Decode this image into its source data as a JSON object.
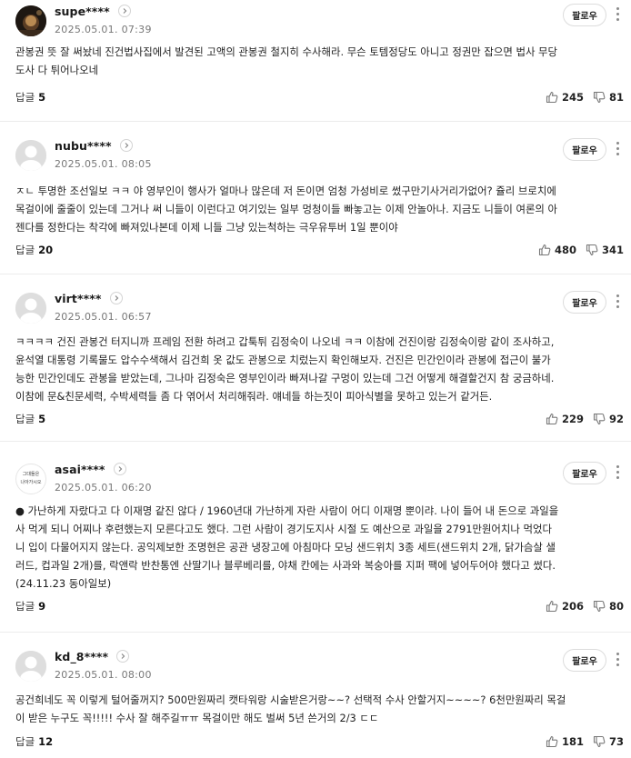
{
  "follow_label": "팔로우",
  "reply_label": "답글",
  "comments": [
    {
      "nickname": "supe****",
      "date": "2025.05.01. 07:39",
      "avatar": "photo",
      "text": "관봉권 뜻 잘 써놨네 진건법사집에서 발견된 고액의 관봉권 철지히 수사해라. 무슨 토템정당도 아니고 정권만 잡으면 법사 무당\n도사 다 튀어나오네",
      "replies": "5",
      "likes": "245",
      "dislikes": "81"
    },
    {
      "nickname": "nubu****",
      "date": "2025.05.01. 08:05",
      "avatar": "default",
      "text": "ㅈㄴ 투명한 조선일보 ㅋㅋ 야 영부인이 행사가 얼마나 많은데 저 돈이면 엄청 가성비로 썼구만기사거리가없어? 쥴리 브로치에\n목걸이에 줄줄이 있는데 그거나 써 니들이 이런다고 여기있는 일부 멍청이들 빠놓고는 이제 안놀아나. 지금도 니들이 여론의 아\n젠다를 정한다는 착각에 빠져있나본데 이제 니들 그냥 있는척하는 극우유투버 1일 뿐이야",
      "replies": "20",
      "likes": "480",
      "dislikes": "341"
    },
    {
      "nickname": "virt****",
      "date": "2025.05.01. 06:57",
      "avatar": "default",
      "text": "ㅋㅋㅋㅋ 건진 관봉건 터지니까 프레임 전환 하려고 갑툭튀 김정숙이 나오네 ㅋㅋ 이참에 건진이랑 김정숙이랑 같이 조사하고,\n윤석열 대통령 기록물도 압수수색해서 김건희 옷 값도 관봉으로 치렀는지 확인해보자. 건진은 민간인이라 관봉에 접근이 불가\n능한 민간인데도 관봉을 받았는데, 그나마 김정숙은 영부인이라 빠져나갈 구멍이 있는데 그건 어떻게 해결할건지 참 궁금하네.\n이참에 문&친문세력, 수박세력들 좀 다 엮어서 처리해줘라. 얘네들 하는짓이 피아식별을 못하고 있는거 같거든.",
      "replies": "5",
      "likes": "229",
      "dislikes": "92"
    },
    {
      "nickname": "asai****",
      "date": "2025.05.01. 06:20",
      "avatar": "text",
      "avatar_text_1": "그대들은",
      "avatar_text_2": "나아가시오",
      "text": "● 가난하게 자랐다고 다 이재명 같진 않다 / 1960년대 가난하게 자란 사람이 어디 이재명 뿐이랴. 나이 들어 내 돈으로 과일을\n사 먹게 되니 어찌나 후련했는지 모른다고도 했다. 그런 사람이 경기도지사 시절 도 예산으로 과일을 2791만원어치나 먹었다\n니 입이 다물어지지 않는다. 공익제보한 조명현은 공관 냉장고에 아침마다 모닝 샌드위치 3종 세트(샌드위치 2개, 닭가슴살 샐\n러드, 컵과일 2개)를, 락앤락 반찬통엔 산딸기나 블루베리를, 야채 칸에는 사과와 복숭아를 지퍼 팩에 넣어두어야 했다고 썼다.\n(24.11.23 동아일보)",
      "replies": "9",
      "likes": "206",
      "dislikes": "80"
    },
    {
      "nickname": "kd_8****",
      "date": "2025.05.01. 08:00",
      "avatar": "default",
      "text": "공건희네도 꼭 이렇게 털어줄꺼지? 500만원짜리 캣타워랑 시술받은거랑~~? 선택적 수사 안할거지~~~~? 6천만원짜리 목걸\n이 받은 누구도 꼭!!!!! 수사 잘 해주길ㅠㅠ 목걸이만 해도 벌써 5년 쓴거의 2/3 ㄷㄷ",
      "replies": "12",
      "likes": "181",
      "dislikes": "73"
    }
  ]
}
